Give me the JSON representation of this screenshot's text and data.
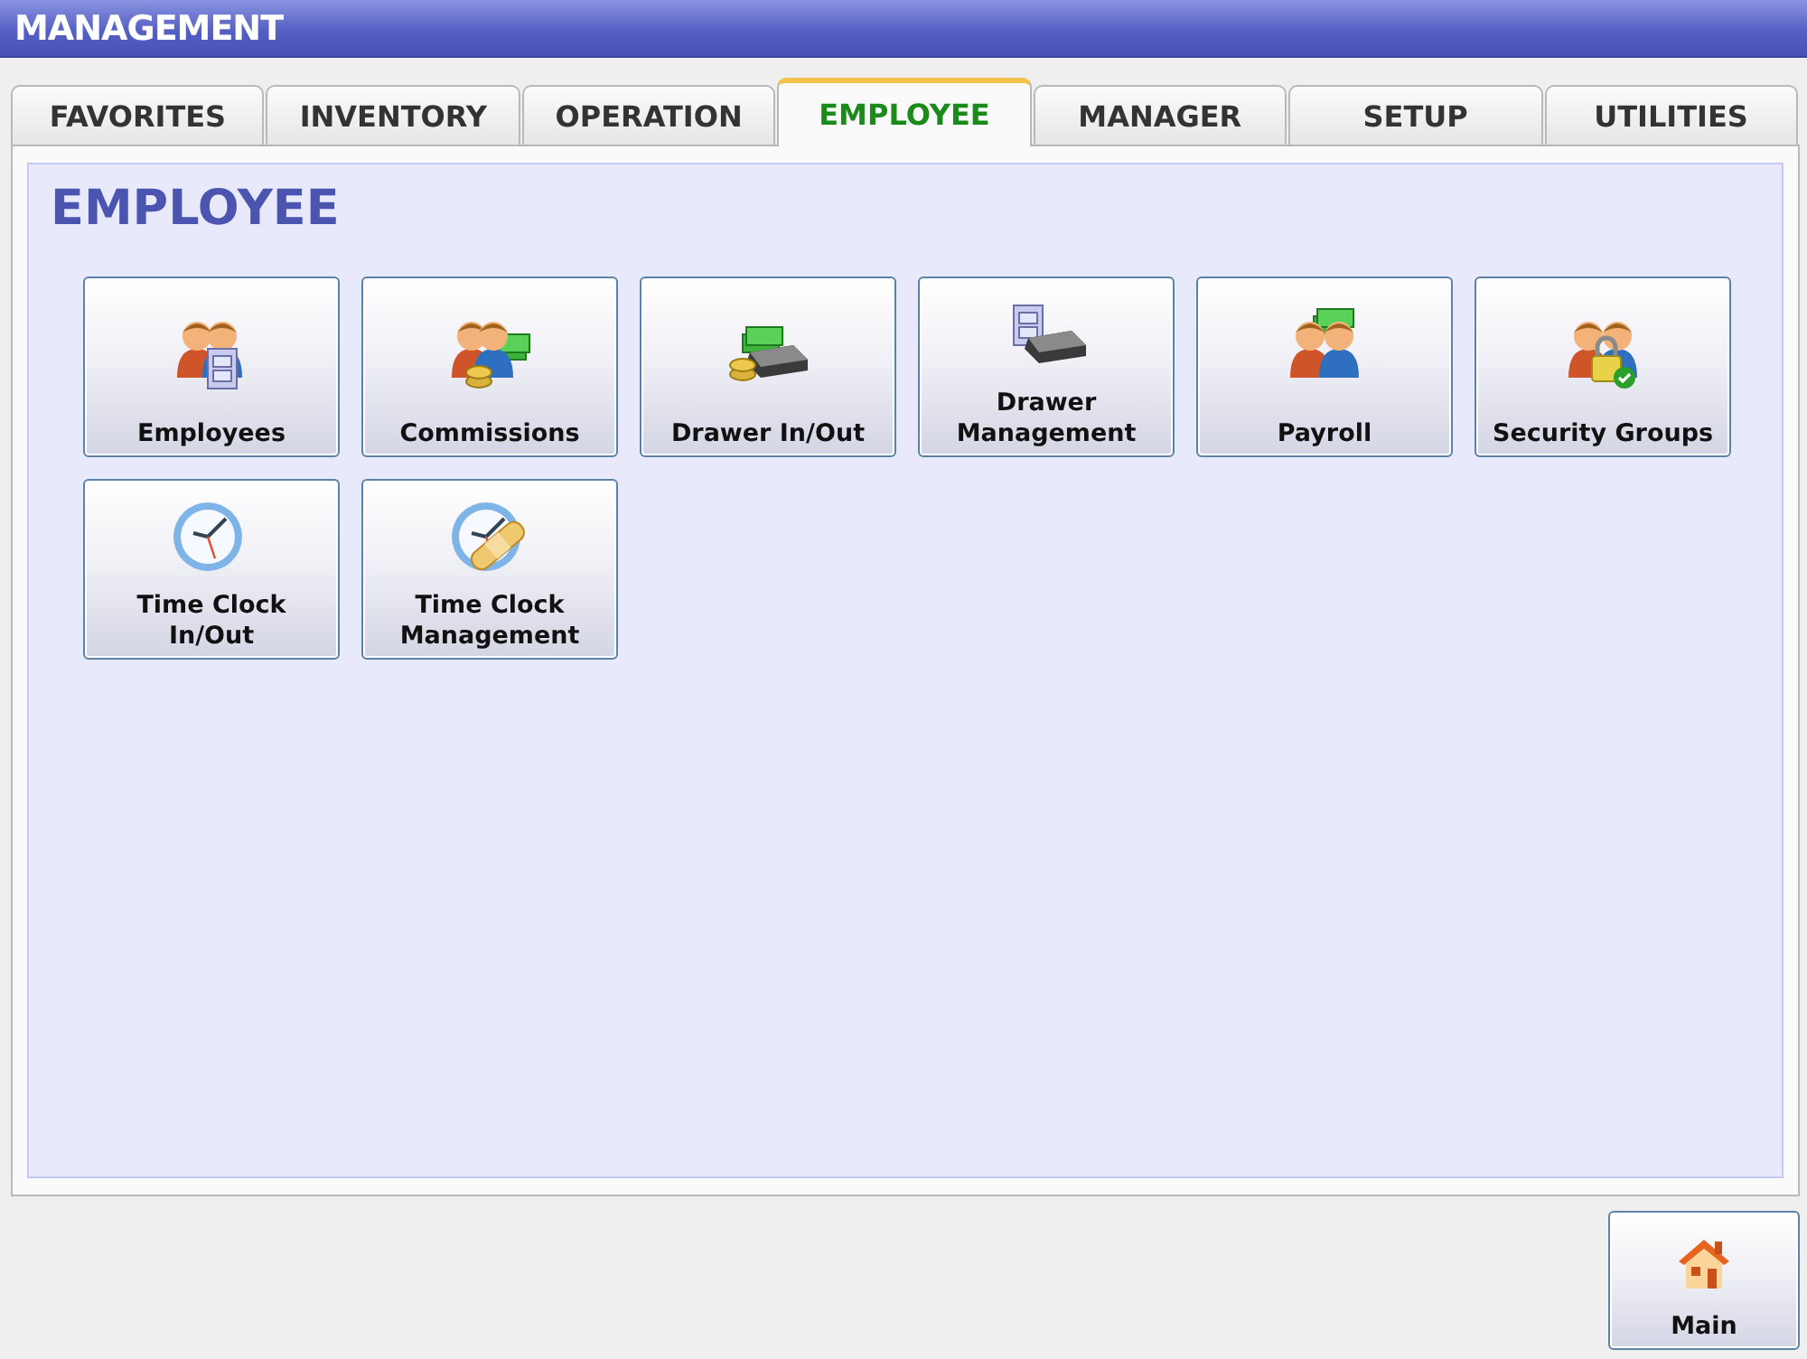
{
  "window": {
    "title": "MANAGEMENT"
  },
  "tabs": [
    {
      "label": "FAVORITES",
      "selected": false
    },
    {
      "label": "INVENTORY",
      "selected": false
    },
    {
      "label": "OPERATION",
      "selected": false
    },
    {
      "label": "EMPLOYEE",
      "selected": true
    },
    {
      "label": "MANAGER",
      "selected": false
    },
    {
      "label": "SETUP",
      "selected": false
    },
    {
      "label": "UTILITIES",
      "selected": false
    }
  ],
  "section": {
    "heading": "EMPLOYEE"
  },
  "tiles": [
    {
      "lines": [
        "Employees"
      ]
    },
    {
      "lines": [
        "Commissions"
      ]
    },
    {
      "lines": [
        "Drawer In/Out"
      ]
    },
    {
      "lines": [
        "Drawer",
        "Management"
      ]
    },
    {
      "lines": [
        "Payroll"
      ]
    },
    {
      "lines": [
        "Security Groups"
      ]
    },
    {
      "lines": [
        "Time Clock",
        "In/Out"
      ]
    },
    {
      "lines": [
        "Time Clock",
        "Management"
      ]
    }
  ],
  "main_button": {
    "label": "Main"
  }
}
